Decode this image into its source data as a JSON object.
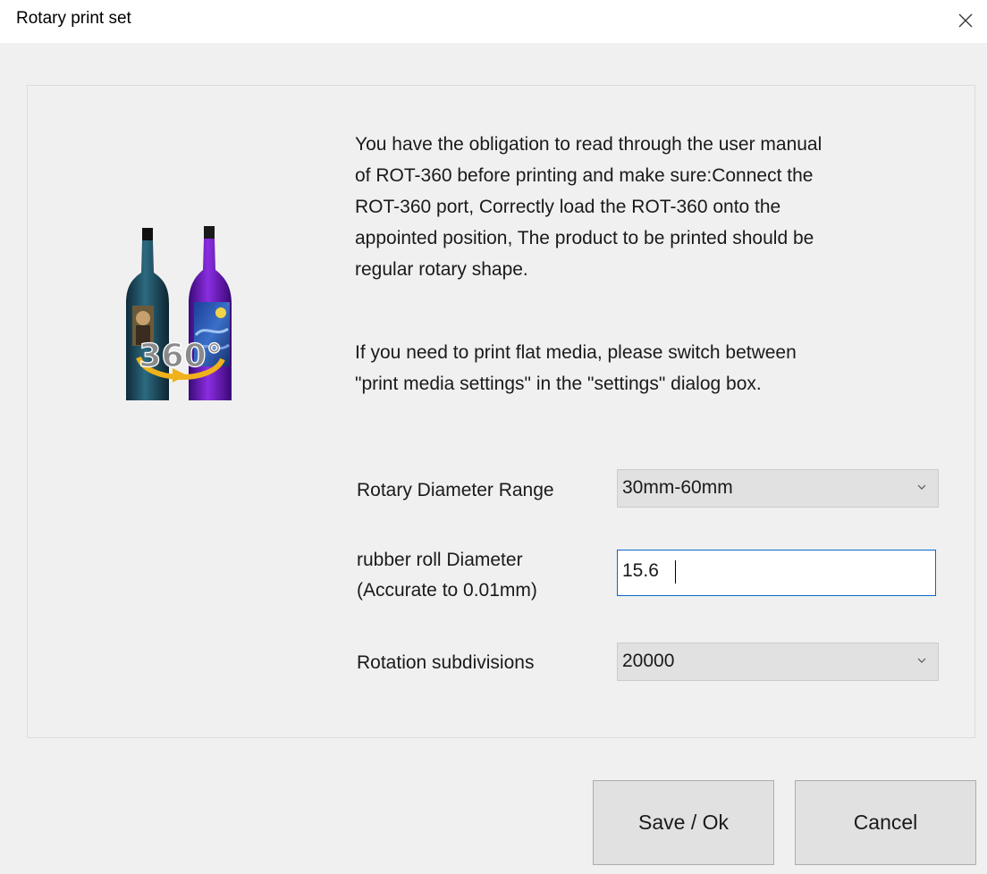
{
  "window": {
    "title": "Rotary print set"
  },
  "notice": {
    "paragraph1": [
      "You have the obligation to read through the user manual",
      "of ROT-360  before printing and make sure:Connect the",
      "ROT-360 port, Correctly load the ROT-360 onto the",
      "appointed position, The product to be printed should be",
      "regular rotary shape."
    ],
    "paragraph2": [
      "If you need to print flat media, please switch between",
      "\"print media settings\" in the \"settings\" dialog box."
    ]
  },
  "illustration": {
    "badge_text": "360°"
  },
  "form": {
    "diameter_range": {
      "label": "Rotary Diameter Range",
      "value": "30mm-60mm"
    },
    "rubber_roll": {
      "label_line1": "rubber roll Diameter",
      "label_line2": "(Accurate to 0.01mm)",
      "value": "15.6"
    },
    "subdivisions": {
      "label": "Rotation subdivisions",
      "value": "20000"
    }
  },
  "buttons": {
    "save": "Save / Ok",
    "cancel": "Cancel"
  }
}
